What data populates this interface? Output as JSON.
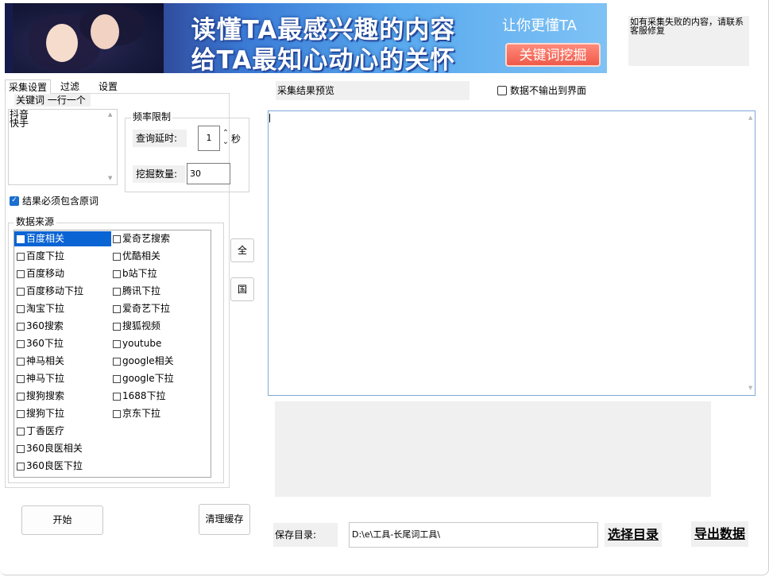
{
  "banner": {
    "headline_line1": "读懂TA最感兴趣的内容",
    "headline_line2": "给TA最知心动心的关怀",
    "tagline": "让你更懂TA",
    "button_label": "关键词挖掘"
  },
  "notice": "如有采集失败的内容，请联系客服修复",
  "tabs": [
    {
      "label": "采集设置"
    },
    {
      "label": "过滤"
    },
    {
      "label": "设置"
    }
  ],
  "keywords": {
    "label": "关键词 一行一个",
    "text": "抖音\n快手"
  },
  "rate_limit": {
    "legend": "频率限制",
    "delay_label": "查询延时:",
    "delay_value": "1",
    "delay_unit": "秒",
    "count_label": "挖掘数量:",
    "count_value": "30"
  },
  "must_contain": {
    "label": "结果必须包含原词",
    "checked": true
  },
  "data_source": {
    "legend": "数据来源",
    "left": [
      {
        "label": "百度相关",
        "checked": true,
        "selected": true
      },
      {
        "label": "百度下拉",
        "checked": false
      },
      {
        "label": "百度移动",
        "checked": false
      },
      {
        "label": "百度移动下拉",
        "checked": false
      },
      {
        "label": "淘宝下拉",
        "checked": false
      },
      {
        "label": "360搜索",
        "checked": false
      },
      {
        "label": "360下拉",
        "checked": false
      },
      {
        "label": "神马相关",
        "checked": false
      },
      {
        "label": "神马下拉",
        "checked": false
      },
      {
        "label": "搜狗搜索",
        "checked": false
      },
      {
        "label": "搜狗下拉",
        "checked": false
      },
      {
        "label": "丁香医疗",
        "checked": false
      },
      {
        "label": "360良医相关",
        "checked": false
      },
      {
        "label": "360良医下拉",
        "checked": false
      }
    ],
    "right": [
      {
        "label": "爱奇艺搜索",
        "checked": false
      },
      {
        "label": "优酷相关",
        "checked": false
      },
      {
        "label": "b站下拉",
        "checked": false
      },
      {
        "label": "腾讯下拉",
        "checked": false
      },
      {
        "label": "爱奇艺下拉",
        "checked": false
      },
      {
        "label": "搜狐视频",
        "checked": false
      },
      {
        "label": "youtube",
        "checked": false
      },
      {
        "label": "google相关",
        "checked": false
      },
      {
        "label": "google下拉",
        "checked": false
      },
      {
        "label": "1688下拉",
        "checked": false
      },
      {
        "label": "京东下拉",
        "checked": false
      }
    ]
  },
  "side_buttons": {
    "all": "全",
    "domestic": "国"
  },
  "buttons": {
    "start": "开始",
    "clear_cache": "清理缓存"
  },
  "preview": {
    "label": "采集结果预览",
    "no_output_label": "数据不输出到界面",
    "no_output_checked": false
  },
  "save": {
    "label": "保存目录:",
    "path": "D:\\e\\工具-长尾词工具\\",
    "choose_dir": "选择目录",
    "export": "导出数据"
  },
  "colors": {
    "selection": "#0a64d4",
    "panel_gray": "#f0f0f0",
    "checkbox_blue": "#1a6fd0"
  }
}
